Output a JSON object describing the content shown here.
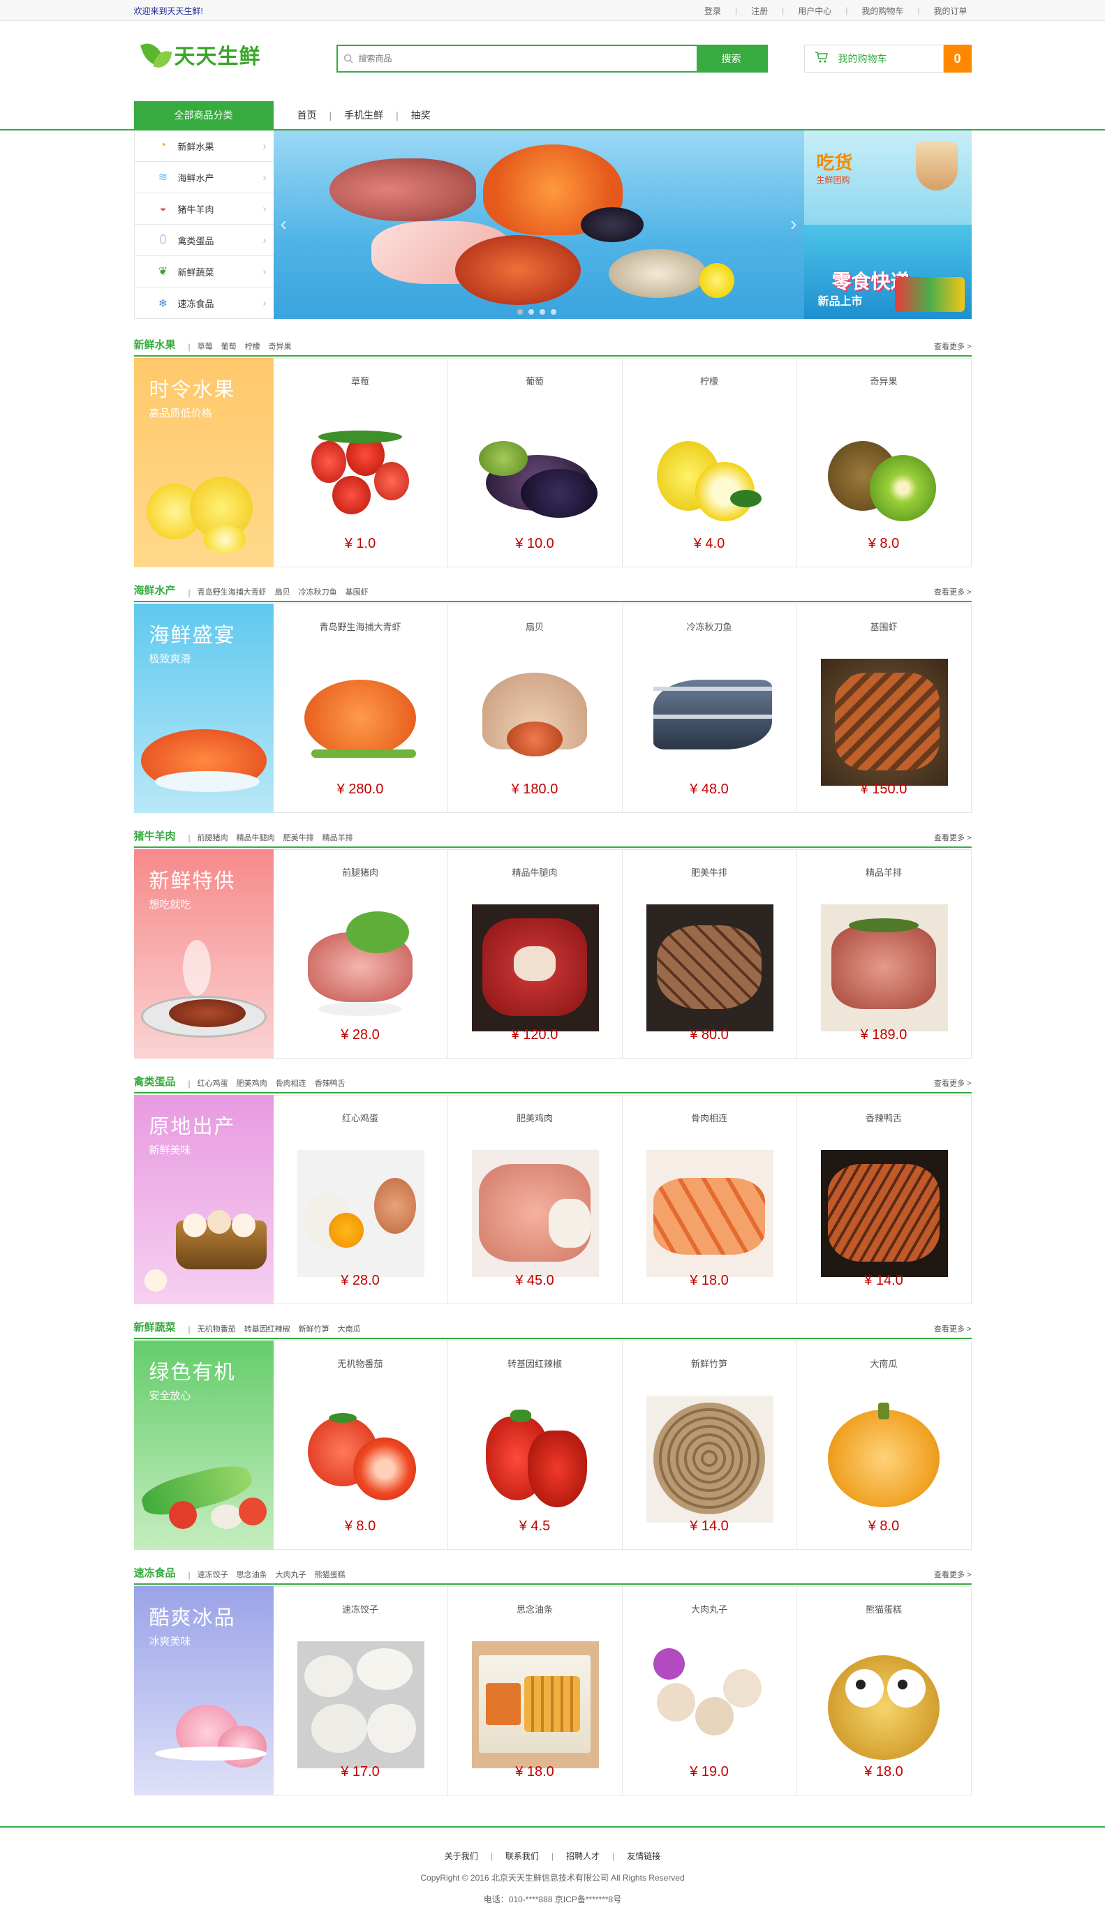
{
  "topbar": {
    "welcome": "欢迎来到天天生鲜!",
    "links": [
      "登录",
      "注册",
      "用户中心",
      "我的购物车",
      "我的订单"
    ]
  },
  "header": {
    "logo_text": "天天生鲜",
    "search_placeholder": "搜索商品",
    "search_button": "搜索",
    "cart_label": "我的购物车",
    "cart_count": "0"
  },
  "nav": {
    "all_categories": "全部商品分类",
    "links": [
      "首页",
      "手机生鲜",
      "抽奖"
    ]
  },
  "category_menu": [
    {
      "label": "新鲜水果",
      "icon": "fruit-icon"
    },
    {
      "label": "海鲜水产",
      "icon": "seafood-icon"
    },
    {
      "label": "猪牛羊肉",
      "icon": "meat-icon"
    },
    {
      "label": "禽类蛋品",
      "icon": "egg-icon"
    },
    {
      "label": "新鲜蔬菜",
      "icon": "vegetable-icon"
    },
    {
      "label": "速冻食品",
      "icon": "snowflake-icon"
    }
  ],
  "ads": {
    "ad1_title": "吃货",
    "ad1_sub": "生鲜团购",
    "ad2_title": "零食快递",
    "ad2_sub": "新品上市"
  },
  "more_label": "查看更多 >",
  "sections": [
    {
      "title": "新鲜水果",
      "tags": [
        "草莓",
        "葡萄",
        "柠檬",
        "奇异果"
      ],
      "promo_title": "时令水果",
      "promo_sub": "高品质低价格",
      "products": [
        {
          "name": "草莓",
          "price": "¥ 1.0"
        },
        {
          "name": "葡萄",
          "price": "¥ 10.0"
        },
        {
          "name": "柠檬",
          "price": "¥ 4.0"
        },
        {
          "name": "奇异果",
          "price": "¥ 8.0"
        }
      ]
    },
    {
      "title": "海鲜水产",
      "tags": [
        "青岛野生海捕大青虾",
        "扇贝",
        "冷冻秋刀鱼",
        "基围虾"
      ],
      "promo_title": "海鲜盛宴",
      "promo_sub": "极致爽滑",
      "products": [
        {
          "name": "青岛野生海捕大青虾",
          "price": "¥ 280.0"
        },
        {
          "name": "扇贝",
          "price": "¥ 180.0"
        },
        {
          "name": "冷冻秋刀鱼",
          "price": "¥ 48.0"
        },
        {
          "name": "基围虾",
          "price": "¥ 150.0"
        }
      ]
    },
    {
      "title": "猪牛羊肉",
      "tags": [
        "前腿猪肉",
        "精品牛腿肉",
        "肥美牛排",
        "精品羊排"
      ],
      "promo_title": "新鲜特供",
      "promo_sub": "想吃就吃",
      "products": [
        {
          "name": "前腿猪肉",
          "price": "¥ 28.0"
        },
        {
          "name": "精品牛腿肉",
          "price": "¥ 120.0"
        },
        {
          "name": "肥美牛排",
          "price": "¥ 80.0"
        },
        {
          "name": "精品羊排",
          "price": "¥ 189.0"
        }
      ]
    },
    {
      "title": "禽类蛋品",
      "tags": [
        "红心鸡蛋",
        "肥美鸡肉",
        "骨肉相连",
        "香辣鸭舌"
      ],
      "promo_title": "原地出产",
      "promo_sub": "新鲜美味",
      "products": [
        {
          "name": "红心鸡蛋",
          "price": "¥ 28.0"
        },
        {
          "name": "肥美鸡肉",
          "price": "¥ 45.0"
        },
        {
          "name": "骨肉相连",
          "price": "¥ 18.0"
        },
        {
          "name": "香辣鸭舌",
          "price": "¥ 14.0"
        }
      ]
    },
    {
      "title": "新鲜蔬菜",
      "tags": [
        "无机物番茄",
        "转基因红辣椒",
        "新鲜竹笋",
        "大南瓜"
      ],
      "promo_title": "绿色有机",
      "promo_sub": "安全放心",
      "products": [
        {
          "name": "无机物番茄",
          "price": "¥ 8.0"
        },
        {
          "name": "转基因红辣椒",
          "price": "¥ 4.5"
        },
        {
          "name": "新鲜竹笋",
          "price": "¥ 14.0"
        },
        {
          "name": "大南瓜",
          "price": "¥ 8.0"
        }
      ]
    },
    {
      "title": "速冻食品",
      "tags": [
        "速冻饺子",
        "思念油条",
        "大肉丸子",
        "熊猫蛋糕"
      ],
      "promo_title": "酷爽冰品",
      "promo_sub": "冰爽美味",
      "products": [
        {
          "name": "速冻饺子",
          "price": "¥ 17.0"
        },
        {
          "name": "思念油条",
          "price": "¥ 18.0"
        },
        {
          "name": "大肉丸子",
          "price": "¥ 19.0"
        },
        {
          "name": "熊猫蛋糕",
          "price": "¥ 18.0"
        }
      ]
    }
  ],
  "footer": {
    "links": [
      "关于我们",
      "联系我们",
      "招聘人才",
      "友情链接"
    ],
    "copyright": "CopyRight © 2016 北京天天生鲜信息技术有限公司 All Rights Reserved",
    "tel": "电话：010-****888 京ICP备*******8号"
  },
  "colors": {
    "brand_green": "#37ab40",
    "price_red": "#c40000",
    "cart_orange": "#ff8800"
  }
}
